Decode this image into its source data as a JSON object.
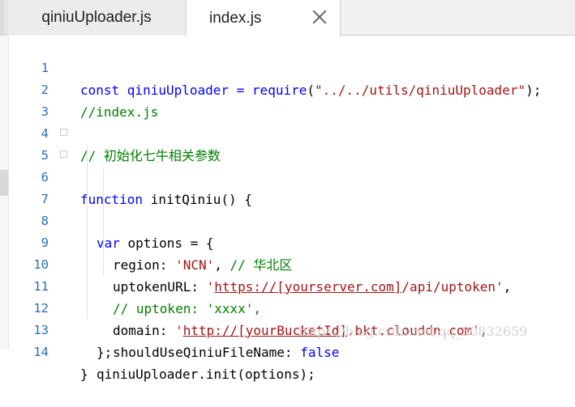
{
  "tabs": [
    {
      "label": "qiniuUploader.js",
      "active": false
    },
    {
      "label": "index.js",
      "active": true
    }
  ],
  "lines": [
    {
      "num": "1",
      "p": [
        "const qiniuUploader = ",
        "require",
        "(",
        "\"../../utils/qiniuUploader\"",
        ");"
      ]
    },
    {
      "num": "2",
      "p": [
        "//index.js"
      ]
    },
    {
      "num": "3",
      "p": []
    },
    {
      "num": "4",
      "p": [
        "// 初始化七牛相关参数"
      ]
    },
    {
      "num": "5",
      "p": [
        "function",
        " initQiniu() {"
      ]
    },
    {
      "num": "6",
      "p": [
        "var",
        " options = {"
      ]
    },
    {
      "num": "7",
      "p": [
        "region: ",
        "'NCN'",
        ", ",
        "// 华北区"
      ]
    },
    {
      "num": "8",
      "p": [
        "uptokenURL: ",
        "'",
        "https://[yourserver.com]",
        "/api/uptoken'",
        ","
      ]
    },
    {
      "num": "9",
      "p": [
        "// uptoken: 'xxxx',"
      ]
    },
    {
      "num": "10",
      "p": [
        "domain: ",
        "'",
        "http://[yourBucketId]",
        ".bkt.clouddn.com'",
        ","
      ]
    },
    {
      "num": "11",
      "p": [
        "shouldUseQiniuFileName: ",
        "false"
      ]
    },
    {
      "num": "12",
      "p": [
        "};"
      ]
    },
    {
      "num": "13",
      "p": [
        "qiniuUploader.init(options);"
      ]
    },
    {
      "num": "14",
      "p": [
        "}"
      ]
    }
  ],
  "watermark": "https://blog.csdn.net/qq_30832659"
}
